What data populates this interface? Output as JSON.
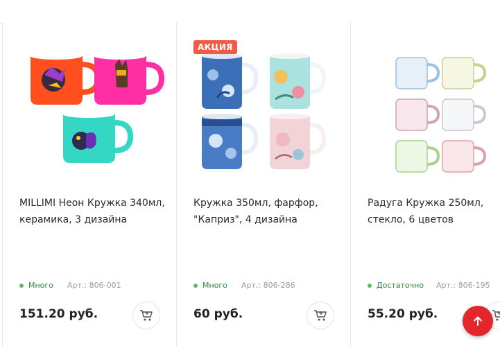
{
  "products": [
    {
      "title": "MILLIMI Неон Кружка 340мл, керамика, 3 дизайна",
      "stock": "Много",
      "sku": "Арт.: 806-001",
      "price": "151.20 руб.",
      "badge": ""
    },
    {
      "title": "Кружка 350мл, фарфор, \"Каприз\", 4 дизайна",
      "stock": "Много",
      "sku": "Арт.: 806-286",
      "price": "60 руб.",
      "badge": "АКЦИЯ"
    },
    {
      "title": "Радуга Кружка 250мл, стекло, 6 цветов",
      "stock": "Достаточно",
      "sku": "Арт.: 806-195",
      "price": "55.20 руб.",
      "badge": ""
    }
  ],
  "icons": {
    "cart": "cart-icon",
    "scroll_top": "arrow-up-icon"
  },
  "colors": {
    "badge_bg": "#f05a47",
    "stock_green": "#5cb85c",
    "scroll_top_bg": "#e3262b"
  }
}
